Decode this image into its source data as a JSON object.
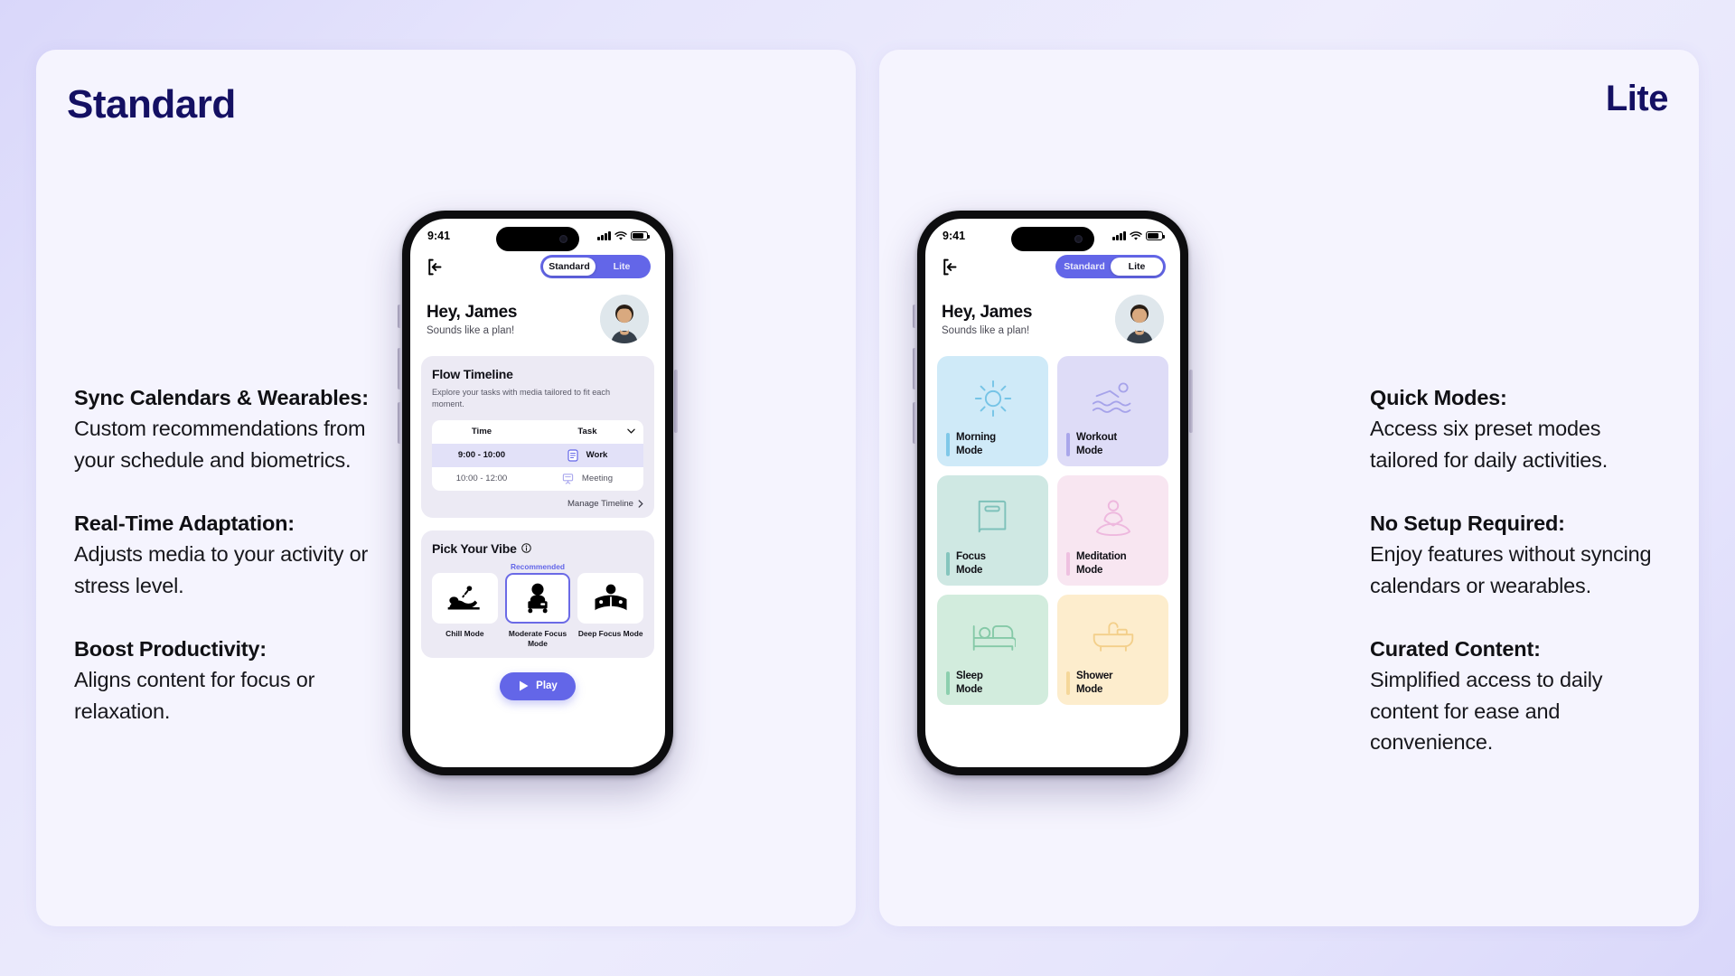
{
  "left_panel": {
    "title": "Standard",
    "features": [
      {
        "heading": "Sync Calendars & Wearables:",
        "body": "Custom recommendations from your schedule and biometrics."
      },
      {
        "heading": "Real-Time Adaptation:",
        "body": "Adjusts media to your activity or stress level."
      },
      {
        "heading": "Boost Productivity:",
        "body": "Aligns content for focus or relaxation."
      }
    ]
  },
  "right_panel": {
    "title": "Lite",
    "features": [
      {
        "heading": "Quick Modes:",
        "body": "Access six preset modes tailored for daily activities."
      },
      {
        "heading": "No Setup Required:",
        "body": "Enjoy features without syncing calendars or wearables."
      },
      {
        "heading": "Curated Content:",
        "body": "Simplified access to daily content for ease and convenience."
      }
    ]
  },
  "status_bar": {
    "time": "9:41",
    "signal_icon": "cellular-bars-icon",
    "wifi_icon": "wifi-icon",
    "battery_icon": "battery-icon"
  },
  "app": {
    "back_icon": "back-arrow-icon",
    "segmented": {
      "options": [
        "Standard",
        "Lite"
      ]
    },
    "greeting": {
      "title": "Hey, James",
      "subtitle": "Sounds like a plan!"
    }
  },
  "standard_screen": {
    "selected_segment": "Standard",
    "timeline": {
      "title": "Flow Timeline",
      "subtitle": "Explore your tasks with media tailored to fit each moment.",
      "columns": [
        "Time",
        "Task"
      ],
      "rows": [
        {
          "time": "9:00 - 10:00",
          "task": "Work",
          "icon": "document-icon",
          "selected": true
        },
        {
          "time": "10:00 - 12:00",
          "task": "Meeting",
          "icon": "presentation-icon",
          "selected": false
        }
      ],
      "manage_link": "Manage Timeline",
      "manage_chevron_icon": "chevron-right-icon",
      "dropdown_icon": "chevron-down-icon"
    },
    "vibe": {
      "title": "Pick Your Vibe",
      "info_icon": "info-icon",
      "recommended_label": "Recommended",
      "options": [
        {
          "label": "Chill Mode",
          "icon": "person-relaxing-icon",
          "selected": false
        },
        {
          "label": "Moderate Focus Mode",
          "icon": "person-laptop-icon",
          "selected": true
        },
        {
          "label": "Deep Focus Mode",
          "icon": "person-reading-icon",
          "selected": false
        }
      ]
    },
    "play_button": {
      "label": "Play",
      "icon": "play-icon"
    }
  },
  "lite_screen": {
    "selected_segment": "Lite",
    "modes": [
      {
        "name": "Morning Mode",
        "line1": "Morning",
        "line2": "Mode",
        "icon": "sun-icon",
        "bg": "#cfeaf8",
        "accent": "#7fc8e8"
      },
      {
        "name": "Workout Mode",
        "line1": "Workout",
        "line2": "Mode",
        "icon": "swimmer-icon",
        "bg": "#dedcf7",
        "accent": "#a9a6ea"
      },
      {
        "name": "Focus Mode",
        "line1": "Focus",
        "line2": "Mode",
        "icon": "book-icon",
        "bg": "#cfe8e3",
        "accent": "#85c5bd"
      },
      {
        "name": "Meditation Mode",
        "line1": "Meditation",
        "line2": "Mode",
        "icon": "meditation-icon",
        "bg": "#f8e6f1",
        "accent": "#eec0e0"
      },
      {
        "name": "Sleep Mode",
        "line1": "Sleep",
        "line2": "Mode",
        "icon": "bed-icon",
        "bg": "#d2ecdd",
        "accent": "#8ccfae"
      },
      {
        "name": "Shower Mode",
        "line1": "Shower",
        "line2": "Mode",
        "icon": "bathtub-icon",
        "bg": "#fdedcd",
        "accent": "#f5d799"
      }
    ]
  },
  "colors": {
    "brand": "#6366e8",
    "title": "#141063",
    "page_bg": "#e4e3fb",
    "panel_bg": "#f5f4fe"
  }
}
